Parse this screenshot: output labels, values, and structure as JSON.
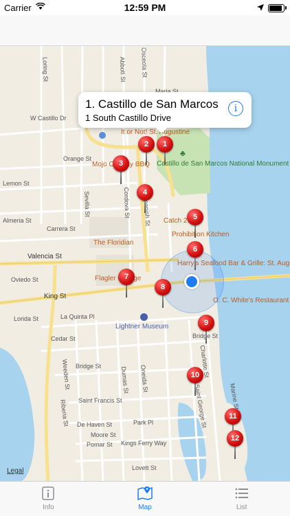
{
  "status_bar": {
    "carrier": "Carrier",
    "time": "12:59 PM"
  },
  "callout": {
    "title": "1. Castillo de San Marcos",
    "subtitle": "1 South Castillo Drive"
  },
  "map": {
    "legal": "Legal",
    "streets": [
      "W Castillo Dr",
      "Orange St",
      "Lemon St",
      "Almeria St",
      "Carrera St",
      "Valencia St",
      "Oviedo St",
      "King St",
      "Lorida St",
      "La Quinta Pl",
      "Cedar St",
      "Bridge St",
      "Saint Francis St",
      "De Haven St",
      "Park Pl",
      "Moore St",
      "Pomar St",
      "Kings Ferry Way",
      "Lovett St",
      "Cordova St",
      "Sevilla St",
      "Spanish St",
      "Charlotte St",
      "Saint George St",
      "Dumas St",
      "Oneida St",
      "Riberia St",
      "Weeden St",
      "Loring St",
      "Abbott St",
      "Osceola St",
      "Marine St",
      "Bridge St",
      "Maria St"
    ],
    "pois": [
      {
        "label": "It or Not! St. Augustine",
        "kind": "orange"
      },
      {
        "label": "Castillo de San Marcos National Monument",
        "kind": "green"
      },
      {
        "label": "Mojo Old City BBQ",
        "kind": "orange"
      },
      {
        "label": "Catch 27",
        "kind": "orange"
      },
      {
        "label": "Prohibition Kitchen",
        "kind": "orange"
      },
      {
        "label": "The Floridian",
        "kind": "orange"
      },
      {
        "label": "Harry's Seafood Bar & Grille: St. Augustine",
        "kind": "orange"
      },
      {
        "label": "Flagler College",
        "kind": "orange"
      },
      {
        "label": "O. C. White's Restaurant",
        "kind": "orange"
      },
      {
        "label": "Lightner Museum",
        "kind": "blue"
      }
    ],
    "pins": [
      "1",
      "2",
      "3",
      "4",
      "5",
      "6",
      "7",
      "8",
      "9",
      "10",
      "11",
      "12"
    ]
  },
  "tabs": [
    {
      "label": "Info",
      "active": false,
      "icon": "info-icon"
    },
    {
      "label": "Map",
      "active": true,
      "icon": "map-icon"
    },
    {
      "label": "List",
      "active": false,
      "icon": "list-icon"
    }
  ],
  "colors": {
    "accent": "#1a7cf5",
    "pin": "#d41212",
    "water": "#a7d3ef",
    "park": "#c7e3b4"
  }
}
